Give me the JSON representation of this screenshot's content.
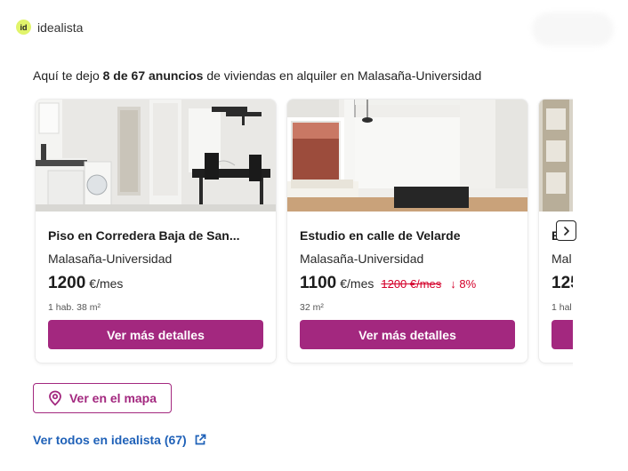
{
  "brand": {
    "logo_text": "id",
    "name": "idealista"
  },
  "intro": {
    "before": "Aquí te dejo ",
    "bold": "8 de 67 anuncios",
    "after": " de viviendas en alquiler en Malasaña-Universidad"
  },
  "listings": [
    {
      "title": "Piso en Corredera Baja de San...",
      "area": "Malasaña-Universidad",
      "price": "1200",
      "price_unit": "€/mes",
      "details": "1 hab.  38 m²",
      "cta": "Ver más detalles"
    },
    {
      "title": "Estudio en calle de Velarde",
      "area": "Malasaña-Universidad",
      "price": "1100",
      "price_unit": "€/mes",
      "old_price": "1200 €/mes",
      "drop": "8%",
      "details": "32 m²",
      "cta": "Ver más detalles"
    },
    {
      "title": "E",
      "area": "Mal",
      "price": "125",
      "details": "1 hal"
    }
  ],
  "map_button": {
    "label": "Ver en el mapa",
    "icon": "map-pin-icon"
  },
  "all_link": {
    "label": "Ver todos en idealista (67)",
    "icon": "external-link-icon"
  },
  "colors": {
    "accent": "#a3287f",
    "link": "#1f61b8",
    "discount": "#d4002a",
    "logo": "#e1f46b"
  }
}
